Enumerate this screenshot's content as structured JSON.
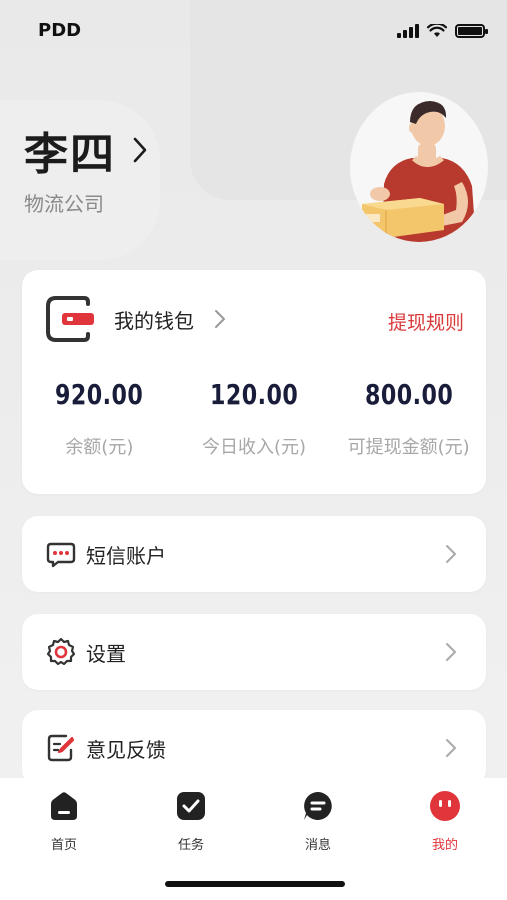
{
  "status_bar": {
    "carrier": "PDD"
  },
  "profile": {
    "name": "李四",
    "company": "物流公司"
  },
  "wallet": {
    "title": "我的钱包",
    "rules_link": "提现规则",
    "stats": [
      {
        "value": "920.00",
        "label": "余额(元)"
      },
      {
        "value": "120.00",
        "label": "今日收入(元)"
      },
      {
        "value": "800.00",
        "label": "可提现金额(元)"
      }
    ]
  },
  "menu": [
    {
      "label": "短信账户",
      "icon": "sms-icon"
    },
    {
      "label": "设置",
      "icon": "gear-icon"
    },
    {
      "label": "意见反馈",
      "icon": "feedback-icon"
    }
  ],
  "tabbar": [
    {
      "label": "首页",
      "icon": "home-icon",
      "active": false
    },
    {
      "label": "任务",
      "icon": "task-icon",
      "active": false
    },
    {
      "label": "消息",
      "icon": "message-icon",
      "active": false
    },
    {
      "label": "我的",
      "icon": "profile-icon",
      "active": true
    }
  ],
  "colors": {
    "accent": "#e0353b",
    "text_dark": "#1c1c1c",
    "value_navy": "#1a1d3a",
    "muted": "#a7a7a7"
  }
}
